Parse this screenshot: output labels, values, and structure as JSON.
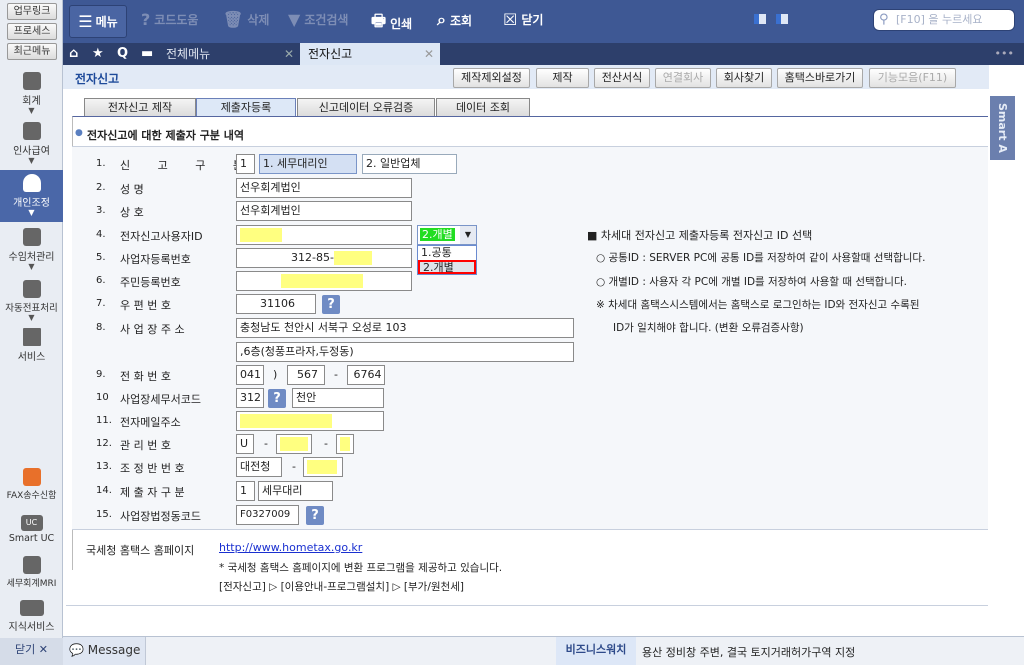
{
  "sidebar": {
    "top_buttons": [
      "업무링크",
      "프로세스",
      "최근메뉴"
    ],
    "items": [
      {
        "label": "회계"
      },
      {
        "label": "인사급여"
      },
      {
        "label": "개인조정"
      },
      {
        "label": "수임처관리"
      },
      {
        "label": "자동전표처리"
      },
      {
        "label": "서비스"
      }
    ],
    "bottom_items": [
      {
        "label": "FAX송수신함"
      },
      {
        "label": "Smart UC"
      },
      {
        "label": "세무회계MRI"
      },
      {
        "label": "지식서비스"
      }
    ],
    "close_label": "닫기 ✕"
  },
  "toolbar": {
    "menu": "메뉴",
    "code_help": "코드도움",
    "delete": "삭제",
    "filter": "조건검색",
    "print": "인쇄",
    "lookup": "조회",
    "close": "닫기",
    "search_placeholder": "[F10] 을 누르세요"
  },
  "window_tabs": [
    {
      "label": "전체메뉴"
    },
    {
      "label": "전자신고"
    }
  ],
  "page": {
    "title": "전자신고",
    "buttons": [
      "제작제외설정",
      "제작",
      "전산서식",
      "연결회사",
      "회사찾기",
      "홈택스바로가기",
      "기능모음(F11)"
    ]
  },
  "sub_tabs": [
    "전자신고 제작",
    "제출자등록",
    "신고데이터 오류검증",
    "데이터 조회"
  ],
  "section_title": "전자신고에 대한 제출자 구분 내역",
  "form": {
    "r1": {
      "num": "1.",
      "label": "신 고 구 분",
      "code": "1",
      "opt1": "1. 세무대리인",
      "opt2": "2. 일반업체"
    },
    "r2": {
      "num": "2.",
      "label": "성 명",
      "value": "선우회계법인"
    },
    "r3": {
      "num": "3.",
      "label": "상 호",
      "value": "선우회계법인"
    },
    "r4": {
      "num": "4.",
      "label": "전자신고사용자ID",
      "select": "2.개별",
      "options": [
        "1.공통",
        "2.개별"
      ]
    },
    "r5": {
      "num": "5.",
      "label": "사업자등록번호",
      "value": "312-85-"
    },
    "r6": {
      "num": "6.",
      "label": "주민등록번호"
    },
    "r7": {
      "num": "7.",
      "label": "우 편 번 호",
      "value": "31106"
    },
    "r8": {
      "num": "8.",
      "label": "사 업 장 주 소",
      "value1": "충청남도 천안시 서북구  오성로 103",
      "value2": ",6층(청풍프라자,두정동)"
    },
    "r9": {
      "num": "9.",
      "label": "전 화 번 호",
      "a": "041",
      "paren": ")",
      "b": "567",
      "dash": "-",
      "c": "6764"
    },
    "r10": {
      "num": "10",
      "label": "사업장세무서코드",
      "code": "312",
      "name": "천안"
    },
    "r11": {
      "num": "11.",
      "label": "전자메일주소"
    },
    "r12": {
      "num": "12.",
      "label": "관 리 번 호",
      "a": "U",
      "dash": "-"
    },
    "r13": {
      "num": "13.",
      "label": "조 정 반 번 호",
      "a": "대전청",
      "dash": "-"
    },
    "r14": {
      "num": "14.",
      "label": "제 출 자 구 분",
      "code": "1",
      "name": "세무대리"
    },
    "r15": {
      "num": "15.",
      "label": "사업장법정동코드",
      "value": "F0327009"
    },
    "help": "?"
  },
  "notes": {
    "title": "■ 차세대 전자신고 제출자등록 전자신고 ID 선택",
    "l1": "○ 공통ID : SERVER PC에 공통 ID를 저장하여 같이 사용할때 선택합니다.",
    "l2": "○ 개별ID : 사용자 각 PC에 개별 ID를 저장하여 사용할 때 선택합니다.",
    "l3": "※ 차세대 홈택스시스템에서는 홈택스로 로그인하는 ID와 전자신고 수록된",
    "l4": "ID가 일치해야 합니다. (변환 오류검증사항)"
  },
  "hometax": {
    "label": "국세청 홈택스 홈페이지",
    "url": "http://www.hometax.go.kr",
    "line1": "* 국세청 홈택스 홈페이지에 변환 프로그램을 제공하고 있습니다.",
    "line2": "[전자신고] ▷ [이용안내-프로그램설치] ▷ [부가/원천세]"
  },
  "smart": "Smart A",
  "bottom": {
    "message": "Message",
    "biz_label": "비즈니스워치",
    "news": "용산 정비창 주변, 결국 토지거래허가구역 지정"
  },
  "colors": {
    "top": "#3e5894",
    "tabbar": "#2d3f6b",
    "highlight": "#ff0000",
    "id_green": "#22dd22"
  }
}
